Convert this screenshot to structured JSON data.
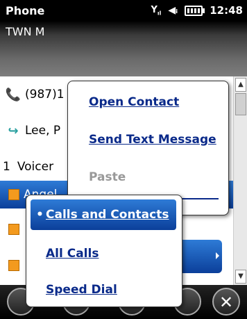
{
  "status": {
    "app_title": "Phone",
    "time": "12:48"
  },
  "header": {
    "title": "TWN M"
  },
  "list": {
    "rows": [
      {
        "text": "(987)1"
      },
      {
        "text": "Lee, P"
      },
      {
        "prefix": "1",
        "text": "Voicer"
      },
      {
        "text": "Angel"
      },
      {
        "text": ""
      },
      {
        "text": ""
      }
    ]
  },
  "context_menu": {
    "items": [
      {
        "label": "Open Contact"
      },
      {
        "label": "Send Text Message"
      },
      {
        "label": "Paste",
        "disabled": true
      }
    ]
  },
  "filter_menu": {
    "items": [
      {
        "label": "Calls and Contacts",
        "selected": true,
        "bullet": "•"
      },
      {
        "label": "All Calls"
      },
      {
        "label": "Speed Dial"
      }
    ]
  },
  "icons": {
    "missed_call": "missed-call-icon",
    "incoming_call": "incoming-call-icon",
    "close": "close-icon"
  },
  "colors": {
    "selection": "#1a56b8",
    "menu_text": "#0a2a8a",
    "missed": "#d02020",
    "incoming": "#2aa0a0"
  }
}
